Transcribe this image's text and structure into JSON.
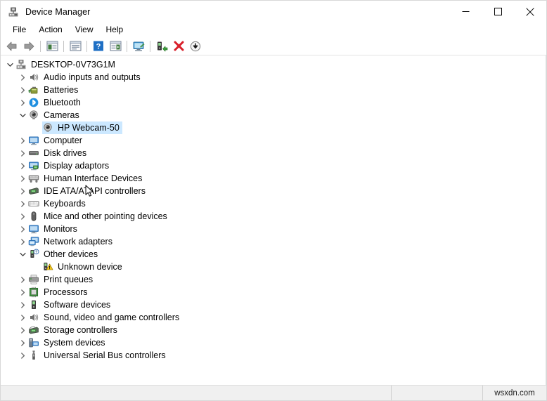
{
  "window": {
    "title": "Device Manager",
    "icon": "device-manager-icon",
    "controls": {
      "minimize": "minimize-icon",
      "maximize": "maximize-icon",
      "close": "close-icon"
    }
  },
  "menubar": {
    "items": [
      {
        "label": "File"
      },
      {
        "label": "Action"
      },
      {
        "label": "View"
      },
      {
        "label": "Help"
      }
    ]
  },
  "toolbar": {
    "buttons": [
      {
        "name": "back-button",
        "icon": "back-arrow-icon"
      },
      {
        "name": "forward-button",
        "icon": "forward-arrow-icon"
      },
      {
        "name": "separator-1",
        "icon": "separator"
      },
      {
        "name": "show-hide-console-tree-button",
        "icon": "console-tree-icon"
      },
      {
        "name": "separator-2",
        "icon": "separator"
      },
      {
        "name": "properties-button",
        "icon": "properties-icon"
      },
      {
        "name": "separator-3",
        "icon": "separator"
      },
      {
        "name": "help-button",
        "icon": "help-question-icon"
      },
      {
        "name": "show-hide-action-pane-button",
        "icon": "action-pane-icon"
      },
      {
        "name": "separator-4",
        "icon": "separator"
      },
      {
        "name": "scan-for-hardware-changes-button",
        "icon": "scan-hardware-icon"
      },
      {
        "name": "separator-5",
        "icon": "separator"
      },
      {
        "name": "update-driver-button",
        "icon": "update-driver-icon"
      },
      {
        "name": "uninstall-device-button",
        "icon": "uninstall-red-x-icon"
      },
      {
        "name": "disable-device-button",
        "icon": "disable-down-arrow-icon"
      }
    ]
  },
  "tree": {
    "nodes": [
      {
        "label": "DESKTOP-0V73G1M",
        "depth": 0,
        "state": "expanded",
        "icon": "computer-root-icon",
        "selected": false
      },
      {
        "label": "Audio inputs and outputs",
        "depth": 1,
        "state": "collapsed",
        "icon": "speaker-icon",
        "selected": false
      },
      {
        "label": "Batteries",
        "depth": 1,
        "state": "collapsed",
        "icon": "battery-icon",
        "selected": false
      },
      {
        "label": "Bluetooth",
        "depth": 1,
        "state": "collapsed",
        "icon": "bluetooth-icon",
        "selected": false
      },
      {
        "label": "Cameras",
        "depth": 1,
        "state": "expanded",
        "icon": "camera-icon",
        "selected": false
      },
      {
        "label": "HP Webcam-50",
        "depth": 2,
        "state": "leaf",
        "icon": "camera-icon",
        "selected": true
      },
      {
        "label": "Computer",
        "depth": 1,
        "state": "collapsed",
        "icon": "monitor-icon",
        "selected": false
      },
      {
        "label": "Disk drives",
        "depth": 1,
        "state": "collapsed",
        "icon": "disk-drive-icon",
        "selected": false
      },
      {
        "label": "Display adaptors",
        "depth": 1,
        "state": "collapsed",
        "icon": "display-adapter-icon",
        "selected": false
      },
      {
        "label": "Human Interface Devices",
        "depth": 1,
        "state": "collapsed",
        "icon": "hid-icon",
        "selected": false
      },
      {
        "label": "IDE ATA/ATAPI controllers",
        "depth": 1,
        "state": "collapsed",
        "icon": "ide-controller-icon",
        "selected": false
      },
      {
        "label": "Keyboards",
        "depth": 1,
        "state": "collapsed",
        "icon": "keyboard-icon",
        "selected": false
      },
      {
        "label": "Mice and other pointing devices",
        "depth": 1,
        "state": "collapsed",
        "icon": "mouse-icon",
        "selected": false
      },
      {
        "label": "Monitors",
        "depth": 1,
        "state": "collapsed",
        "icon": "monitor-icon",
        "selected": false
      },
      {
        "label": "Network adapters",
        "depth": 1,
        "state": "collapsed",
        "icon": "network-adapter-icon",
        "selected": false
      },
      {
        "label": "Other devices",
        "depth": 1,
        "state": "expanded",
        "icon": "unknown-device-question-icon",
        "selected": false
      },
      {
        "label": "Unknown device",
        "depth": 2,
        "state": "leaf",
        "icon": "unknown-device-warning-icon",
        "selected": false
      },
      {
        "label": "Print queues",
        "depth": 1,
        "state": "collapsed",
        "icon": "printer-icon",
        "selected": false
      },
      {
        "label": "Processors",
        "depth": 1,
        "state": "collapsed",
        "icon": "processor-icon",
        "selected": false
      },
      {
        "label": "Software devices",
        "depth": 1,
        "state": "collapsed",
        "icon": "software-device-icon",
        "selected": false
      },
      {
        "label": "Sound, video and game controllers",
        "depth": 1,
        "state": "collapsed",
        "icon": "speaker-icon",
        "selected": false
      },
      {
        "label": "Storage controllers",
        "depth": 1,
        "state": "collapsed",
        "icon": "storage-controller-icon",
        "selected": false
      },
      {
        "label": "System devices",
        "depth": 1,
        "state": "collapsed",
        "icon": "system-device-icon",
        "selected": false
      },
      {
        "label": "Universal Serial Bus controllers",
        "depth": 1,
        "state": "collapsed",
        "icon": "usb-icon",
        "selected": false
      }
    ]
  },
  "statusbar": {
    "main": "",
    "mid": "",
    "watermark": "wsxdn.com"
  },
  "colors": {
    "selection": "#cce8ff",
    "window_bg": "#ffffff",
    "statusbar_bg": "#f0f0f0",
    "warning_yellow": "#ffcc00",
    "error_red": "#e81123",
    "bluetooth_blue": "#2196f3"
  }
}
